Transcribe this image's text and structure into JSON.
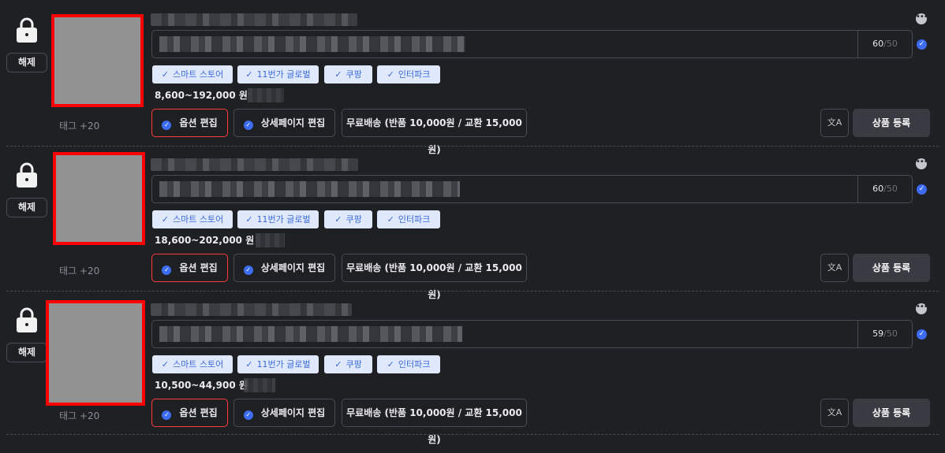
{
  "colors": {
    "background": "#1f2024",
    "accent_blue": "#3d6cf0",
    "chip_bg": "#dfe9fb",
    "chip_text": "#3b6bd8",
    "thumb_border": "#ff0000",
    "option_border": "#ff3b3b"
  },
  "labels": {
    "unlock": "해제",
    "option_edit": "옵션 편집",
    "detail_edit": "상세페이지 편집",
    "register": "상품 등록"
  },
  "icons": {
    "lock": "lock-icon",
    "more": "more-icon",
    "check": "check-circle-icon",
    "translate": "translate-icon"
  },
  "products": [
    {
      "tag_count": "태그 +20",
      "name_count": "60",
      "name_max": "/50",
      "markets": [
        {
          "label": "스마트 스토어",
          "checked": true
        },
        {
          "label": "11번가 글로벌",
          "checked": true
        },
        {
          "label": "쿠팡",
          "checked": true
        },
        {
          "label": "인터파크",
          "checked": true
        }
      ],
      "price": "8,600~192,000 원",
      "shipping": "무료배송 (반품 10,000원 / 교환 15,000원)"
    },
    {
      "tag_count": "태그 +20",
      "name_count": "60",
      "name_max": "/50",
      "markets": [
        {
          "label": "스마트 스토어",
          "checked": true
        },
        {
          "label": "11번가 글로벌",
          "checked": true
        },
        {
          "label": "쿠팡",
          "checked": true
        },
        {
          "label": "인터파크",
          "checked": true
        }
      ],
      "price": "18,600~202,000 원",
      "shipping": "무료배송 (반품 10,000원 / 교환 15,000원)"
    },
    {
      "tag_count": "태그 +20",
      "name_count": "59",
      "name_max": "/50",
      "markets": [
        {
          "label": "스마트 스토어",
          "checked": true
        },
        {
          "label": "11번가 글로벌",
          "checked": true
        },
        {
          "label": "쿠팡",
          "checked": true
        },
        {
          "label": "인터파크",
          "checked": true
        }
      ],
      "price": "10,500~44,900 원",
      "shipping": "무료배송 (반품 10,000원 / 교환 15,000원)"
    }
  ]
}
